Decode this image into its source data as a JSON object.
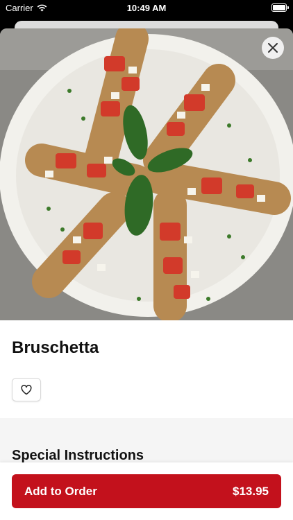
{
  "status_bar": {
    "carrier": "Carrier",
    "time": "10:49 AM"
  },
  "item": {
    "name": "Bruschetta"
  },
  "sections": {
    "special_instructions": "Special Instructions"
  },
  "add_to_order": {
    "label": "Add to Order",
    "price": "$13.95"
  },
  "colors": {
    "accent": "#c3111c"
  },
  "icons": [
    "wifi-icon",
    "battery-icon",
    "close-icon",
    "heart-icon"
  ]
}
